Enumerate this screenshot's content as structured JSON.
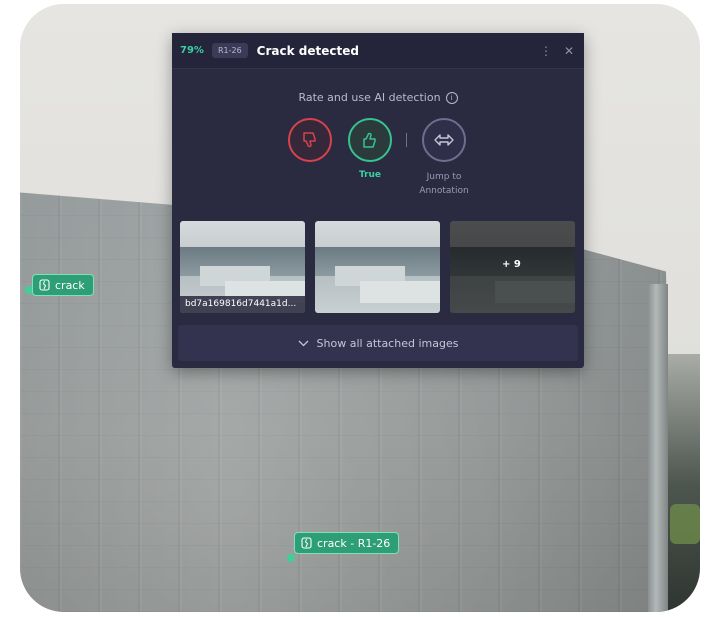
{
  "scene": {
    "tags": [
      {
        "label": "crack"
      },
      {
        "label": "crack - R1-26"
      }
    ]
  },
  "panel": {
    "confidence": "79%",
    "id": "R1-26",
    "title": "Crack detected",
    "rate_prompt": "Rate and use AI detection",
    "actions": {
      "true_label": "True",
      "jump_label_line1": "Jump to",
      "jump_label_line2": "Annotation"
    },
    "thumbnails": [
      {
        "caption": "bd7a169816d7441a1d..."
      },
      {
        "caption": ""
      },
      {
        "more": "+ 9"
      }
    ],
    "show_all_label": "Show all attached images"
  },
  "colors": {
    "accent": "#3ad1a0",
    "danger": "#d7434a",
    "panel_bg": "#2a2a41",
    "tag_bg": "#2e9e77"
  },
  "icons": {
    "false": "thumbs-down-icon",
    "true": "thumbs-up-icon",
    "jump": "arrows-left-right-icon",
    "more": "kebab-menu-icon",
    "close": "close-icon",
    "info": "info-icon",
    "chevron": "chevron-down-icon",
    "tag": "crack-tag-icon"
  }
}
